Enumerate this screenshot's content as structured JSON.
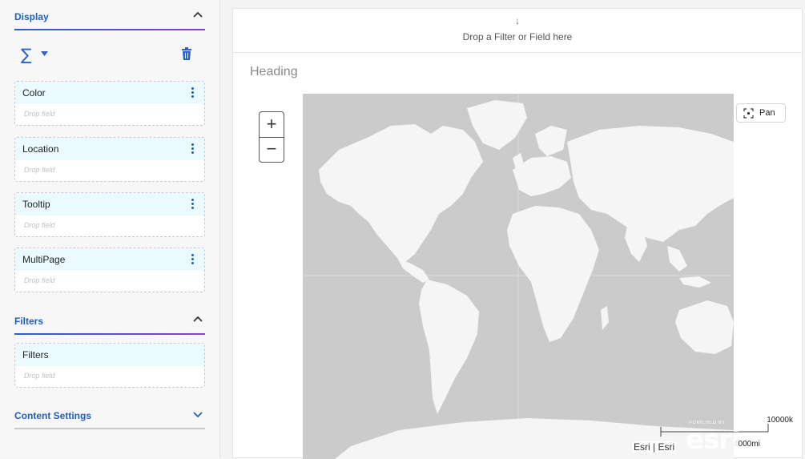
{
  "panel": {
    "display": {
      "title": "Display"
    },
    "fields": [
      {
        "label": "Color",
        "hint": "Drop field"
      },
      {
        "label": "Location",
        "hint": "Drop field"
      },
      {
        "label": "Tooltip",
        "hint": "Drop field"
      },
      {
        "label": "MultiPage",
        "hint": "Drop field"
      }
    ],
    "filters": {
      "title": "Filters",
      "box_label": "Filters",
      "hint": "Drop field"
    },
    "content_settings": {
      "title": "Content Settings"
    },
    "icons": {
      "aggregate": "sigma-icon",
      "dropdown": "caret-down-icon",
      "delete": "trash-icon"
    },
    "colors": {
      "accent": "#1f5fbf",
      "field_bg": "#eafaff"
    }
  },
  "main": {
    "dropzone_text": "Drop a Filter or Field here",
    "heading": "Heading",
    "map": {
      "zoom_in": "+",
      "zoom_out": "−",
      "pan_label": "Pan",
      "scale_top": "10000k",
      "scale_bottom": "4000mi",
      "attribution": "Esri | Esri",
      "logo_text": "esri",
      "logo_small": "POWERED BY"
    }
  }
}
